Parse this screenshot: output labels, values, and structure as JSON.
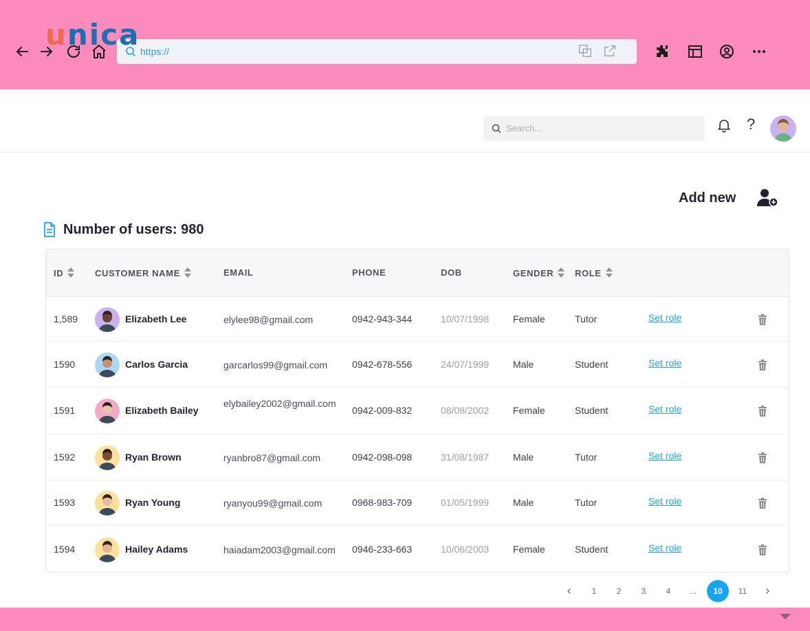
{
  "browser": {
    "url": "https://"
  },
  "header": {
    "logo": {
      "u": "u",
      "rest": "nica"
    },
    "search_placeholder": "Search...",
    "help": "?"
  },
  "page": {
    "add_new": "Add new",
    "users_count": "Number of users: 980"
  },
  "table": {
    "columns": [
      "ID",
      "CUSTOMER NAME",
      "EMAIL",
      "PHONE",
      "DOB",
      "GENDER",
      "ROLE"
    ],
    "set_role_label": "Set role",
    "rows": [
      {
        "id": "1,589",
        "name": "Elizabeth Lee",
        "email": "elylee98@gmail.com",
        "phone": "0942-943-344",
        "dob": "10/07/1998",
        "gender": "Female",
        "role": "Tutor",
        "avatar_bg": "#c9b0ee",
        "skin": "#6b4431"
      },
      {
        "id": "1590",
        "name": "Carlos Garcia",
        "email": "garcarlos99@gmail.com",
        "phone": "0942-678-556",
        "dob": "24/07/1999",
        "gender": "Male",
        "role": "Student",
        "avatar_bg": "#a9d8f2",
        "skin": "#c9906c"
      },
      {
        "id": "1591",
        "name": "Elizabeth Bailey",
        "email": "elybailey2002@gmail.com",
        "phone": "0942-009-832",
        "dob": "08/08/2002",
        "gender": "Female",
        "role": "Student",
        "avatar_bg": "#f6a9c7",
        "skin": "#e9c3a6"
      },
      {
        "id": "1592",
        "name": "Ryan Brown",
        "email": "ryanbro87@gmail.com",
        "phone": "0942-098-098",
        "dob": "31/08/1987",
        "gender": "Male",
        "role": "Tutor",
        "avatar_bg": "#fbe19c",
        "skin": "#7a4c30"
      },
      {
        "id": "1593",
        "name": "Ryan Young",
        "email": "ryanyou99@gmail.com",
        "phone": "0968-983-709",
        "dob": "01/05/1999",
        "gender": "Male",
        "role": "Tutor",
        "avatar_bg": "#fbe19c",
        "skin": "#e7bf9f"
      },
      {
        "id": "1594",
        "name": "Hailey Adams",
        "email": "haiadam2003@gmail.com",
        "phone": "0946-233-663",
        "dob": "10/06/2003",
        "gender": "Female",
        "role": "Student",
        "avatar_bg": "#fbe19c",
        "skin": "#e0b48f"
      }
    ]
  },
  "pagination": {
    "pages": [
      "1",
      "2",
      "3",
      "4",
      "...",
      "10",
      "11"
    ],
    "active": "10"
  },
  "colors": {
    "chrome": "#fb8abd",
    "accent": "#18a4f0",
    "logo_u": "#ef6c4a",
    "logo_rest": "#1a6fb0"
  }
}
